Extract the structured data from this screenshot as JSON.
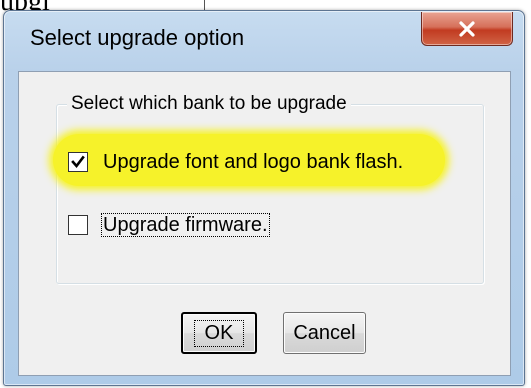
{
  "background": {
    "partial_text": "upgi"
  },
  "window": {
    "title": "Select upgrade option",
    "close_icon": "close-icon",
    "close_color": "#c7432a"
  },
  "group": {
    "legend": "Select which bank to be upgrade"
  },
  "options": [
    {
      "label": "Upgrade font and logo bank flash.",
      "checked": true,
      "highlight_color": "#f6f22a"
    },
    {
      "label": "Upgrade firmware.",
      "checked": false,
      "focused": true
    }
  ],
  "buttons": {
    "ok_label": "OK",
    "cancel_label": "Cancel"
  }
}
